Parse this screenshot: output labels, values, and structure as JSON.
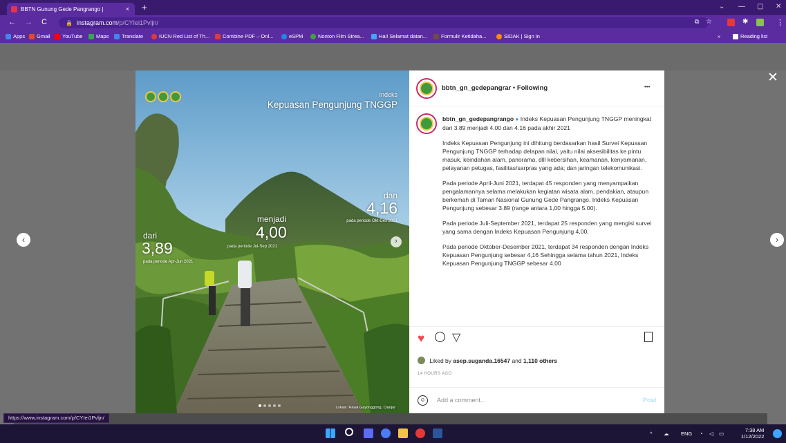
{
  "browser": {
    "tab_title": "BBTN Gunung Gede Pangrango | ",
    "tab_close": "×",
    "new_tab": "+",
    "url_host": "instagram.com",
    "url_path": "/p/CYIei1Pvljn/",
    "bookmarks": [
      {
        "label": "Apps",
        "color": "#f4b400"
      },
      {
        "label": "Gmail",
        "color": "#ea4335"
      },
      {
        "label": "YouTube",
        "color": "#ff0000"
      },
      {
        "label": "Maps",
        "color": "#34a853"
      },
      {
        "label": "Translate",
        "color": "#4285f4"
      },
      {
        "label": "IUCN Red List of Th...",
        "color": "#e53935"
      },
      {
        "label": "Combine PDF – Onl...",
        "color": "#e53935"
      },
      {
        "label": "eSPM",
        "color": "#1e88e5"
      },
      {
        "label": "Nonton Film Strea...",
        "color": "#43a047"
      },
      {
        "label": "Hai! Selamat datan...",
        "color": "#42a5f5"
      },
      {
        "label": "Formulir Ketidaha...",
        "color": "#6d4c41"
      },
      {
        "label": "SIDAK | Sign In",
        "color": "#fb8c00"
      }
    ],
    "reading_list": "Reading list",
    "status_url": "https://www.instagram.com/p/CYIei1Pvljn/"
  },
  "photo": {
    "title_small": "Indeks",
    "title_big": "Kepuasan Pengunjung TNGGP",
    "label_dari": "dari",
    "value_1": "3,89",
    "period_1": "pada periode Apr-Jun 2021",
    "label_menjadi": "menjadi",
    "value_2": "4,00",
    "period_2": "pada periode Jul-Sep 2021",
    "label_dan": "dan",
    "value_3": "4,16",
    "period_3": "pada periode Okt-Des 2021",
    "location": "Lokasi: Rawa Gayonggong, Cianjur"
  },
  "post": {
    "header_user": "bbtn_gn_gedepangrar",
    "header_sep": " • ",
    "header_follow": "Following",
    "more": "•••",
    "caption_user": "bbtn_gn_gedepangrango",
    "caption_lead": "Indeks Kepuasan Pengunjung TNGGP meningkat dari 3.89 menjadi 4.00 dan 4.16 pada akhir 2021",
    "paragraphs": [
      "Indeks Kepuasan Pengunjung ini dihitung berdasarkan hasil Survei Kepuasan Pengunjung TNGGP terhadap delapan nilai, yaitu nilai aksesibilitas ke pintu masuk, keindahan alam, panorama, dlll kebersihan, keamanan, kenyamanan, pelayanan petugas, fasilitas/sarpras yang ada; dan jaringan telekomunikasi.",
      "Pada periode April-Juni 2021, terdapat 45 responden yang menyampaikan pengalamannya selama melakukan kegiatan wisata alam, pendakian, ataupun berkemah di Taman Nasional Gunung Gede Pangrango. Indeks Kepuasan Pengunjung sebesar 3.89 (range antara 1,00 hingga 5.00).",
      "Pada periode Juli-September 2021, terdapat 25 responden yang mengisi survei yang sama dengan Indeks Kepuasan Pengunjung 4,00.",
      "Pada periode Oktober-Desember 2021, terdapat 34 responden dengan Indeks Kepuasan Pengunjung sebesar 4,16 Sehingga selama tahun 2021, Indeks Kepuasan Pengunjung TNGGP sebesar 4.00"
    ],
    "liked_prefix": "Liked by ",
    "liked_user": "asep.suganda.16547",
    "liked_mid": " and ",
    "liked_count": "1,110 others",
    "time_ago": "14 HOURS AGO",
    "comment_placeholder": "Add a comment...",
    "post_button": "Post"
  },
  "taskbar": {
    "lang": "ENG",
    "time": "7:38 AM",
    "date": "1/12/2022"
  },
  "colors": {
    "heart": "#ed4956",
    "link": "#0095f6",
    "verified": "#3897f0"
  }
}
